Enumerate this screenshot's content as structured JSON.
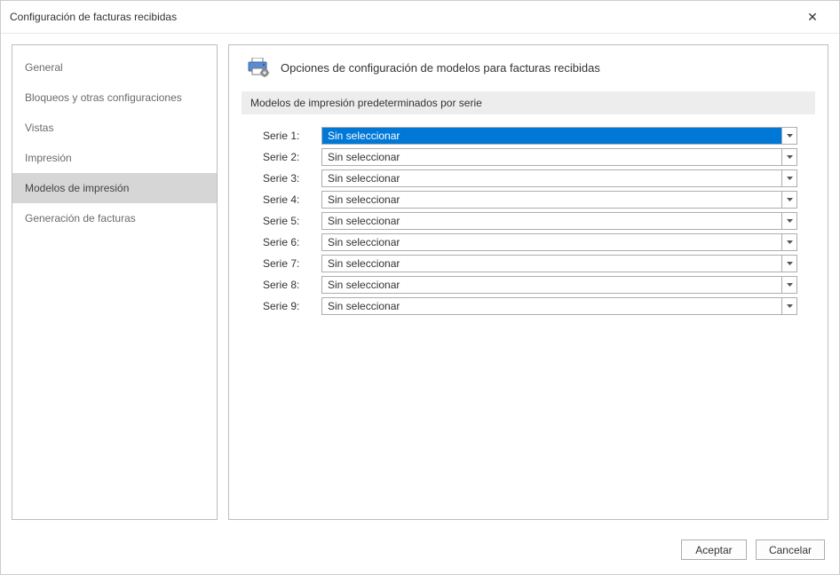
{
  "window": {
    "title": "Configuración de facturas recibidas"
  },
  "sidebar": {
    "items": [
      {
        "label": "General"
      },
      {
        "label": "Bloqueos y otras configuraciones"
      },
      {
        "label": "Vistas"
      },
      {
        "label": "Impresión"
      },
      {
        "label": "Modelos de impresión"
      },
      {
        "label": "Generación de facturas"
      }
    ],
    "active_index": 4
  },
  "panel": {
    "title": "Opciones de configuración de modelos para facturas recibidas",
    "section_title": "Modelos de impresión predeterminados por serie",
    "series": [
      {
        "label": "Serie 1:",
        "value": "Sin seleccionar",
        "highlight": true
      },
      {
        "label": "Serie 2:",
        "value": "Sin seleccionar",
        "highlight": false
      },
      {
        "label": "Serie 3:",
        "value": "Sin seleccionar",
        "highlight": false
      },
      {
        "label": "Serie 4:",
        "value": "Sin seleccionar",
        "highlight": false
      },
      {
        "label": "Serie 5:",
        "value": "Sin seleccionar",
        "highlight": false
      },
      {
        "label": "Serie 6:",
        "value": "Sin seleccionar",
        "highlight": false
      },
      {
        "label": "Serie 7:",
        "value": "Sin seleccionar",
        "highlight": false
      },
      {
        "label": "Serie 8:",
        "value": "Sin seleccionar",
        "highlight": false
      },
      {
        "label": "Serie 9:",
        "value": "Sin seleccionar",
        "highlight": false
      }
    ]
  },
  "footer": {
    "accept_label": "Aceptar",
    "cancel_label": "Cancelar"
  }
}
